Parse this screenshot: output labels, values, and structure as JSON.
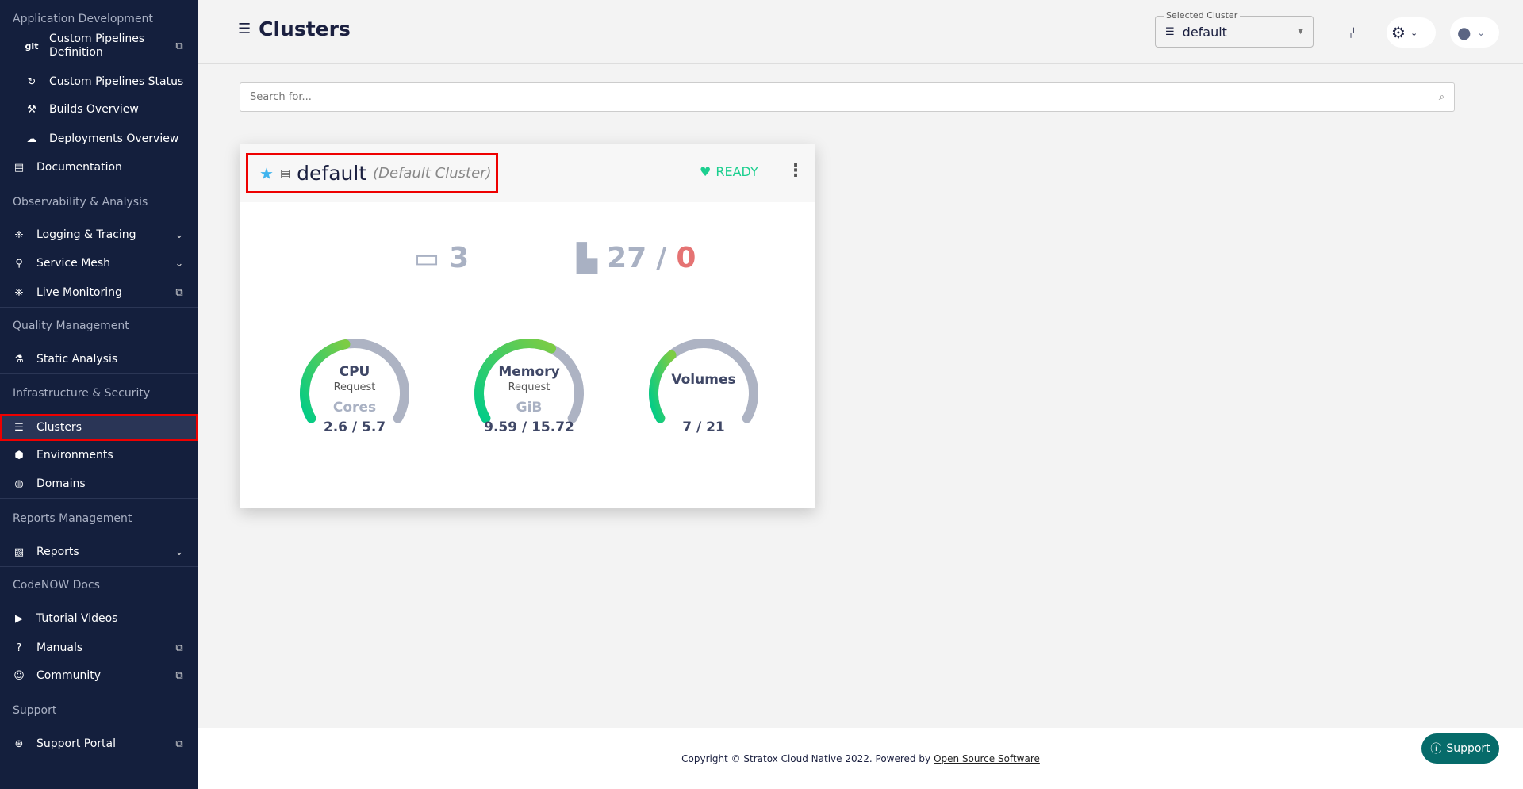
{
  "sidebar": {
    "sections": [
      {
        "title": "Application Development",
        "items": [
          {
            "label": "Custom Pipelines Definition",
            "icon": "git-icon",
            "glyph": "git",
            "sub": true,
            "trailing": "external-link-icon"
          },
          {
            "label": "Custom Pipelines Status",
            "icon": "refresh-icon",
            "glyph": "↻",
            "sub": true
          },
          {
            "label": "Builds Overview",
            "icon": "hammer-icon",
            "glyph": "⚒",
            "sub": true
          },
          {
            "label": "Deployments Overview",
            "icon": "cloud-icon",
            "glyph": "☁",
            "sub": true
          },
          {
            "label": "Documentation",
            "icon": "book-icon",
            "glyph": "▤"
          }
        ]
      },
      {
        "title": "Observability & Analysis",
        "items": [
          {
            "label": "Logging & Tracing",
            "icon": "binoculars-icon",
            "glyph": "⛯",
            "trailing": "chevron-down-icon"
          },
          {
            "label": "Service Mesh",
            "icon": "hubspot-icon",
            "glyph": "⚲",
            "trailing": "chevron-down-icon"
          },
          {
            "label": "Live Monitoring",
            "icon": "binoculars-icon",
            "glyph": "⛯",
            "trailing": "external-link-icon"
          }
        ]
      },
      {
        "title": "Quality Management",
        "items": [
          {
            "label": "Static Analysis",
            "icon": "flask-icon",
            "glyph": "⚗"
          }
        ]
      },
      {
        "title": "Infrastructure & Security",
        "items": [
          {
            "label": "Clusters",
            "icon": "list-icon",
            "glyph": "☰",
            "active": true
          },
          {
            "label": "Environments",
            "icon": "cube-icon",
            "glyph": "⬢"
          },
          {
            "label": "Domains",
            "icon": "globe-icon",
            "glyph": "◍"
          }
        ]
      },
      {
        "title": "Reports Management",
        "items": [
          {
            "label": "Reports",
            "icon": "csv-file-icon",
            "glyph": "▧",
            "trailing": "chevron-down-icon"
          }
        ]
      },
      {
        "title": "CodeNOW Docs",
        "items": [
          {
            "label": "Tutorial Videos",
            "icon": "video-icon",
            "glyph": "▶"
          },
          {
            "label": "Manuals",
            "icon": "question-icon",
            "glyph": "?",
            "trailing": "external-link-icon"
          },
          {
            "label": "Community",
            "icon": "discord-icon",
            "glyph": "☺",
            "trailing": "external-link-icon"
          }
        ]
      },
      {
        "title": "Support",
        "items": [
          {
            "label": "Support Portal",
            "icon": "lifebuoy-icon",
            "glyph": "⊛",
            "trailing": "external-link-icon"
          }
        ]
      }
    ]
  },
  "header": {
    "title": "Clusters",
    "selected_cluster_label": "Selected Cluster",
    "selected_cluster": "default"
  },
  "search": {
    "placeholder": "Search for..."
  },
  "card": {
    "name": "default",
    "subtitle": "(Default Cluster)",
    "status": "READY",
    "status_color": "#1ccf8f",
    "nodes": "3",
    "pods_running": "27",
    "pods_separator": "/",
    "pods_failed": "0",
    "failed_color": "#e57373",
    "gauges": [
      {
        "title": "CPU",
        "subtitle": "Request",
        "unit": "Cores",
        "value": "2.6 / 5.7",
        "used": 2.6,
        "total": 5.7
      },
      {
        "title": "Memory",
        "subtitle": "Request",
        "unit": "GiB",
        "value": "9.59 / 15.72",
        "used": 9.59,
        "total": 15.72
      },
      {
        "title": "Volumes",
        "subtitle": "",
        "unit": "",
        "value": "7 / 21",
        "used": 7,
        "total": 21
      }
    ]
  },
  "footer": {
    "text": "Copyright © Stratox Cloud Native 2022. Powered by",
    "link": "Open Source Software"
  },
  "support_button": "Support"
}
